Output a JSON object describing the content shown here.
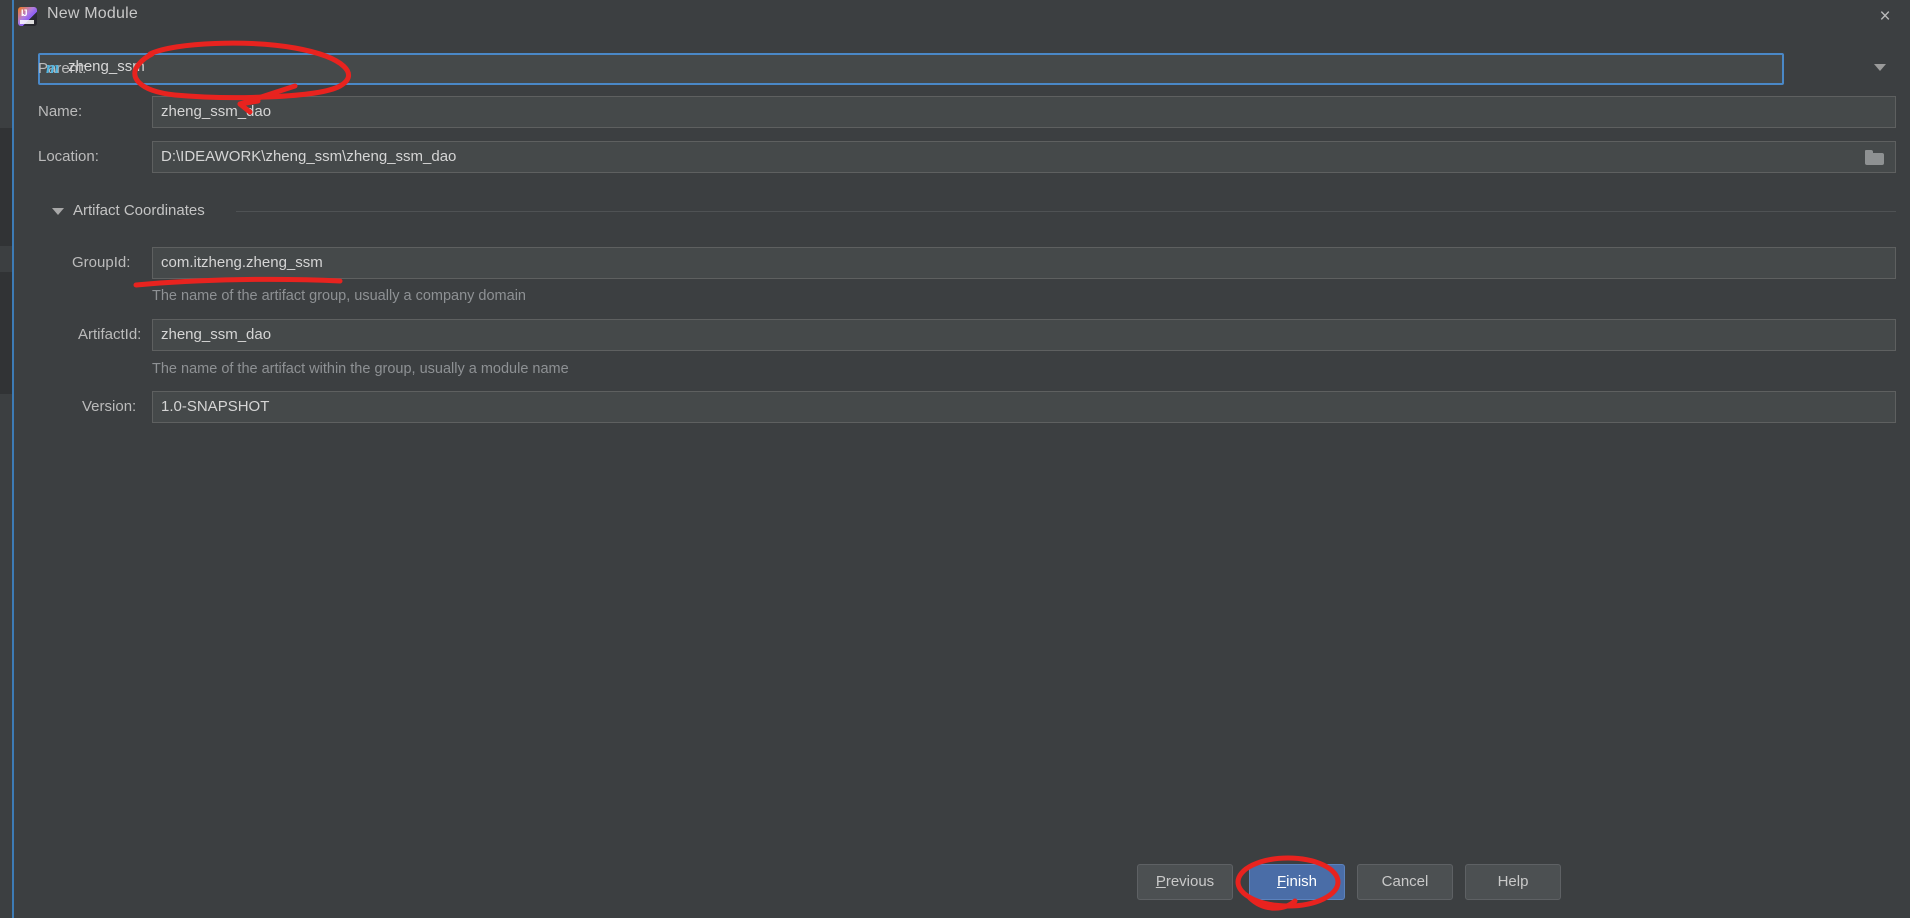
{
  "window": {
    "title": "New Module",
    "app_icon": "intellij-idea-icon",
    "close_label": "×"
  },
  "form": {
    "parent": {
      "label": "Parent:",
      "value": "zheng_ssm",
      "icon": "maven-module-icon",
      "icon_letter": "m",
      "dropdown_icon": "chevron-down-icon",
      "focused": true
    },
    "name": {
      "label": "Name:",
      "value": "zheng_ssm_dao",
      "placeholder": ""
    },
    "location": {
      "label": "Location:",
      "value": "D:\\IDEAWORK\\zheng_ssm\\zheng_ssm_dao",
      "placeholder": "",
      "browse_icon": "folder-browse-icon"
    }
  },
  "artifact_coordinates": {
    "section_title": "Artifact Coordinates",
    "expanded": true,
    "collapse_icon": "triangle-down-icon",
    "group_id": {
      "label": "GroupId:",
      "value": "com.itzheng.zheng_ssm",
      "hint": "The name of the artifact group, usually a company domain"
    },
    "artifact_id": {
      "label": "ArtifactId:",
      "value": "zheng_ssm_dao",
      "hint": "The name of the artifact within the group, usually a module name"
    },
    "version": {
      "label": "Version:",
      "value": "1.0-SNAPSHOT",
      "hint": ""
    }
  },
  "buttons": {
    "previous": {
      "label": "Previous",
      "mnemonic": "P",
      "primary": false
    },
    "finish": {
      "label": "Finish",
      "mnemonic": "F",
      "primary": true
    },
    "cancel": {
      "label": "Cancel",
      "mnemonic": "",
      "primary": false
    },
    "help": {
      "label": "Help",
      "mnemonic": "",
      "primary": false
    }
  },
  "annotations": {
    "color": "#e8231f",
    "marks": [
      {
        "name": "parent-field-circle",
        "shape": "ellipse-with-arrow"
      },
      {
        "name": "groupid-underline",
        "shape": "underline-stroke"
      },
      {
        "name": "finish-button-circle",
        "shape": "ellipse-with-tail"
      }
    ]
  },
  "colors": {
    "dialog_background": "#3c3f41",
    "field_background": "#45494a",
    "focus_border": "#4a88c7",
    "primary_button": "#4a6da7",
    "annotation_red": "#e8231f",
    "maven_icon": "#52b5e0"
  }
}
